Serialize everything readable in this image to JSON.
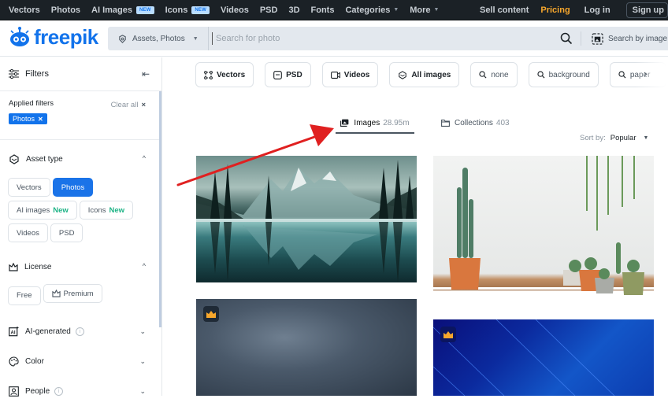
{
  "topnav": {
    "items": [
      {
        "label": "Vectors"
      },
      {
        "label": "Photos"
      },
      {
        "label": "AI Images",
        "badge": "NEW"
      },
      {
        "label": "Icons",
        "badge": "NEW"
      },
      {
        "label": "Videos"
      },
      {
        "label": "PSD"
      },
      {
        "label": "3D"
      },
      {
        "label": "Fonts"
      },
      {
        "label": "Categories",
        "dropdown": true
      },
      {
        "label": "More",
        "dropdown": true
      }
    ],
    "sell_content": "Sell content",
    "pricing": "Pricing",
    "login": "Log in",
    "signup": "Sign up"
  },
  "header": {
    "logo_text": "freepik",
    "brand_color": "#1273eb",
    "search": {
      "scope": "Assets, Photos",
      "placeholder": "Search for photo",
      "value": "",
      "search_by_image": "Search by image"
    }
  },
  "sidebar": {
    "title": "Filters",
    "applied": {
      "title": "Applied filters",
      "clear_all": "Clear all",
      "chips": [
        "Photos"
      ]
    },
    "asset_type": {
      "title": "Asset type",
      "options": [
        {
          "label": "Vectors",
          "active": false
        },
        {
          "label": "Photos",
          "active": true
        },
        {
          "label": "AI images",
          "new": "New"
        },
        {
          "label": "Icons",
          "new": "New"
        },
        {
          "label": "Videos"
        },
        {
          "label": "PSD"
        }
      ]
    },
    "license": {
      "title": "License",
      "options": [
        "Free",
        "Premium"
      ]
    },
    "ai_generated": {
      "title": "AI-generated"
    },
    "color": {
      "title": "Color"
    },
    "people": {
      "title": "People"
    }
  },
  "chips": {
    "types": [
      "Vectors",
      "PSD",
      "Videos",
      "All images"
    ],
    "queries": [
      "none",
      "background",
      "paper"
    ]
  },
  "tabs": {
    "images": {
      "label": "Images",
      "count": "28.95m"
    },
    "collections": {
      "label": "Collections",
      "count": "403"
    }
  },
  "sort": {
    "label": "Sort by:",
    "value": "Popular"
  },
  "results": [
    {
      "description": "Mountain lake reflection with pine trees",
      "premium": false
    },
    {
      "description": "Cacti and succulents in pots on wooden shelf",
      "premium": false
    },
    {
      "description": "Dark grey textured concrete background",
      "premium": true
    },
    {
      "description": "Blue abstract diagonal light streaks background",
      "premium": true
    }
  ],
  "colors": {
    "pricing": "#f7a72c",
    "new_badge": "#1eb386",
    "active_chip": "#1a73e8",
    "annotation_arrow": "#e02020"
  }
}
